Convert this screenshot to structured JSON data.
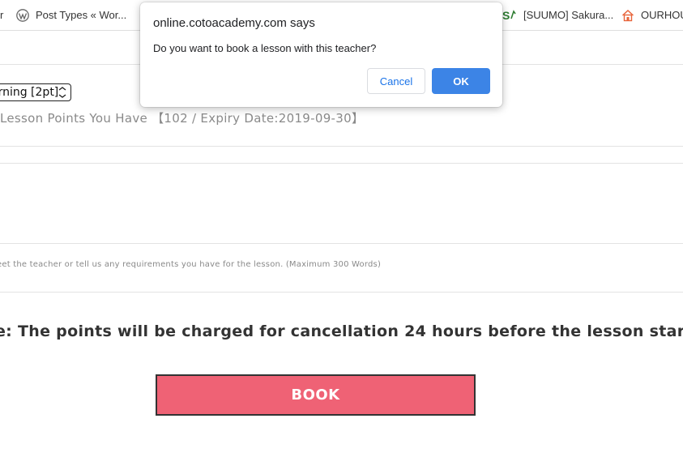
{
  "bookmarks": {
    "items": [
      {
        "label": "r",
        "icon": "none"
      },
      {
        "label": "Post Types « Wor...",
        "icon": "wordpress-icon"
      },
      {
        "label": "[SUUMO] Sakura...",
        "icon": "suumo-icon"
      },
      {
        "label": "OURHOU",
        "icon": "house-icon"
      }
    ]
  },
  "form": {
    "lesson_select": "arning [2pt]",
    "points_text": "Lesson Points You Have 【102 / Expiry Date:2019-09-30】",
    "note_hint": "eet the teacher or tell us any requirements you have for the lesson. (Maximum 300 Words)",
    "notice": "e: The points will be charged for cancellation 24 hours before the lesson starting time.",
    "book_label": "BOOK"
  },
  "dialog": {
    "title": "online.cotoacademy.com says",
    "message": "Do you want to book a lesson with this teacher?",
    "cancel_label": "Cancel",
    "ok_label": "OK"
  },
  "colors": {
    "book_button": "#ef6275",
    "ok_button": "#3c84e6",
    "cancel_text": "#1a73e8",
    "notice_text": "#333333",
    "muted_text": "#8a8a8a"
  }
}
